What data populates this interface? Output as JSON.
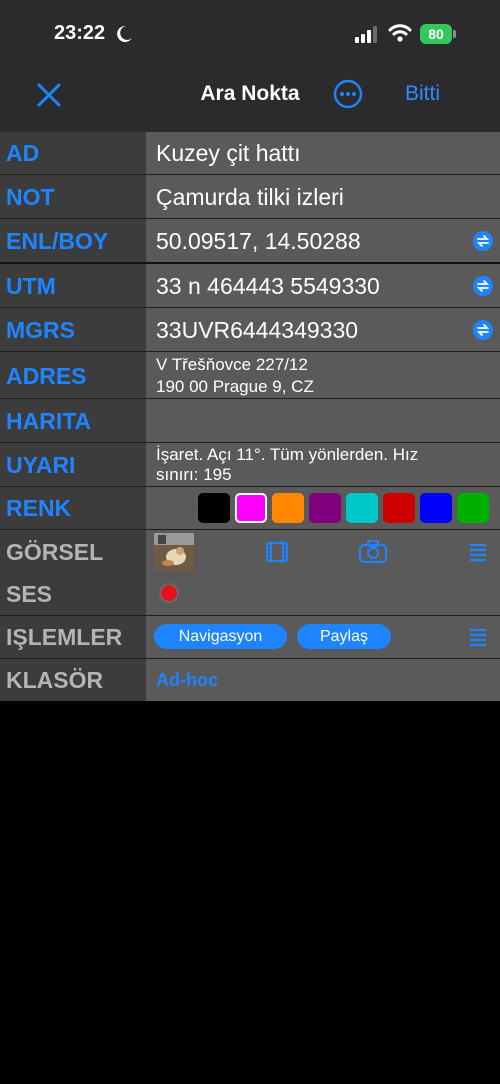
{
  "status_bar": {
    "time": "23:22",
    "battery": "80"
  },
  "nav": {
    "title": "Ara Nokta",
    "done_label": "Bitti"
  },
  "fields": {
    "ad": {
      "label": "AD",
      "value": "Kuzey çit hattı"
    },
    "not": {
      "label": "NOT",
      "value": "Çamurda tilki izleri"
    },
    "enlboy": {
      "label": "ENL/BOY",
      "value": "50.09517, 14.50288"
    },
    "utm": {
      "label": "UTM",
      "value": "33 n 464443 5549330"
    },
    "mgrs": {
      "label": "MGRS",
      "value": "33UVR6444349330"
    },
    "adres": {
      "label": "ADRES",
      "line1": "V Třešňovce 227/12",
      "line2": "190 00 Prague 9, CZ"
    },
    "harita": {
      "label": "HARITA"
    },
    "uyari": {
      "label": "UYARI",
      "line1": "İşaret. Açı 11°.  Tüm yönlerden. Hız",
      "line2": "sınırı: 195"
    },
    "renk": {
      "label": "RENK"
    },
    "gorsel": {
      "label": "GÖRSEL"
    },
    "ses": {
      "label": "SES"
    },
    "islemler": {
      "label": "IŞLEMLER",
      "nav_button": "Navigasyon",
      "share_button": "Paylaş"
    },
    "klasor": {
      "label": "KLASÖR",
      "value": "Ad-hoc"
    }
  },
  "colors": {
    "accent": "#1f84ff",
    "swatches": [
      "#000000",
      "#ff00ff",
      "#ff8800",
      "#800080",
      "#00c8c8",
      "#cc0000",
      "#0000ff",
      "#00b000"
    ],
    "selected_swatch": "#ff00ff",
    "record": "#e0141e"
  }
}
